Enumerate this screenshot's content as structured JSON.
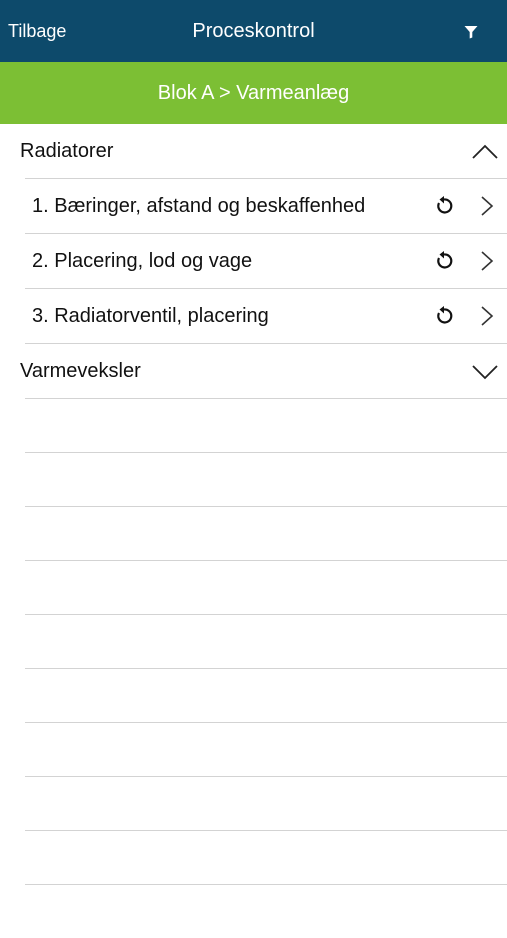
{
  "nav": {
    "back_label": "Tilbage",
    "title": "Proceskontrol",
    "filter_icon": "filter-icon",
    "background": "#0d4a6b"
  },
  "breadcrumb": {
    "text": "Blok A > Varmeanlæg",
    "background": "#7cbf34"
  },
  "sections": [
    {
      "label": "Radiatorer",
      "expanded": true,
      "items": [
        {
          "label": "1. Bæringer, afstand og beskaffenhed"
        },
        {
          "label": "2. Placering, lod og vage"
        },
        {
          "label": "3. Radiatorventil, placering"
        }
      ]
    },
    {
      "label": "Varmeveksler",
      "expanded": false
    }
  ]
}
